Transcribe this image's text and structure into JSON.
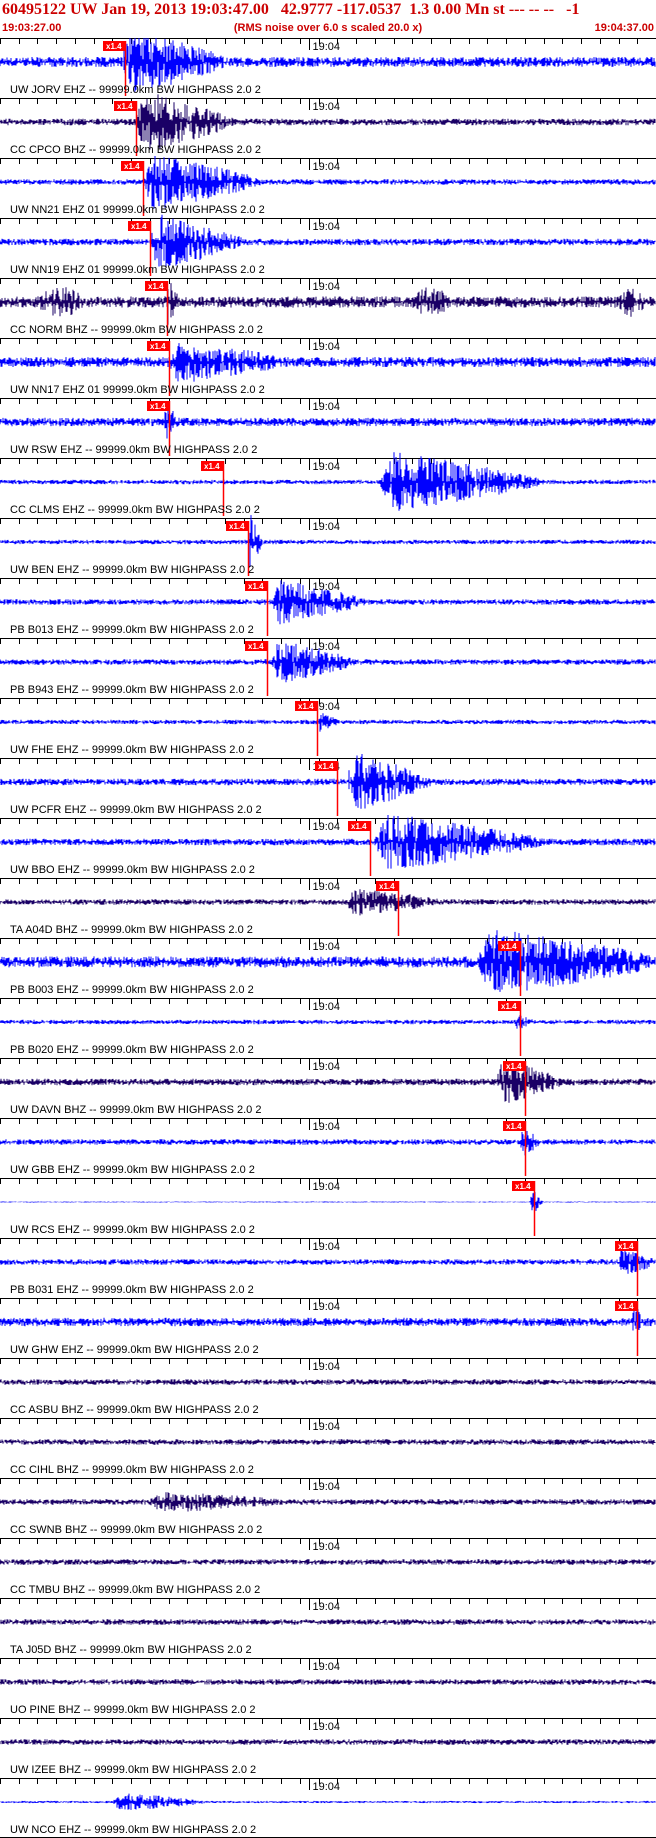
{
  "header": {
    "title": "60495122 UW Jan 19, 2013 19:03:47.00   42.9777 -117.0537  1.3 0.00 Mn st --- -- --   -1",
    "start_time": "19:03:27.00",
    "rms_note": "(RMS noise over 6.0 s scaled 20.0 x)",
    "end_time": "19:04:37.00"
  },
  "colors": {
    "trace_blue": "#0000ff",
    "trace_navy": "#1a0066",
    "pick_red": "#ff0000",
    "header_red": "#cc0000"
  },
  "chart_data": {
    "type": "waveform",
    "x_unit": "seconds after 19:03:27.00",
    "xlim": [
      0,
      70
    ],
    "minute_mark": {
      "label": "19:04",
      "t": 33
    },
    "pick_label": "x1.4",
    "tick_interval_s": 2,
    "traces": [
      {
        "label": "UW JORV EHZ -- 99999.0km BW  HIGHPASS  2.0  2",
        "color": "blue",
        "pick_t": 13.3,
        "burst_t": [
          13.0,
          24.0
        ],
        "amp": 0.18,
        "burst_amp": 1.0,
        "slow_bursts": []
      },
      {
        "label": "CC CPCO BHZ -- 99999.0km BW  HIGHPASS  2.0  2",
        "color": "navy",
        "pick_t": 14.5,
        "burst_t": [
          14.5,
          25.0
        ],
        "amp": 0.12,
        "burst_amp": 1.0,
        "slow_bursts": []
      },
      {
        "label": "UW NN21 EHZ 01 99999.0km BW  HIGHPASS  2.0  2",
        "color": "blue",
        "pick_t": 15.3,
        "burst_t": [
          15.3,
          28.0
        ],
        "amp": 0.1,
        "burst_amp": 0.9,
        "slow_bursts": []
      },
      {
        "label": "UW NN19 EHZ 01 99999.0km BW  HIGHPASS  2.0  2",
        "color": "blue",
        "pick_t": 16.0,
        "burst_t": [
          16.0,
          26.0
        ],
        "amp": 0.12,
        "burst_amp": 0.9,
        "slow_bursts": []
      },
      {
        "label": "CC NORM BHZ -- 99999.0km BW  HIGHPASS  2.0  2",
        "color": "navy",
        "pick_t": 17.8,
        "burst_t": [
          17.8,
          19.0
        ],
        "amp": 0.2,
        "burst_amp": 0.7,
        "slow_bursts": [
          [
            4,
            9
          ],
          [
            44,
            48
          ],
          [
            66,
            69
          ]
        ]
      },
      {
        "label": "UW NN17 EHZ 01 99999.0km BW  HIGHPASS  2.0  2",
        "color": "blue",
        "pick_t": 18.0,
        "burst_t": [
          18.0,
          30.0
        ],
        "amp": 0.18,
        "burst_amp": 0.6,
        "slow_bursts": []
      },
      {
        "label": "UW RSW EHZ -- 99999.0km BW  HIGHPASS  2.0  2",
        "color": "blue",
        "pick_t": 18.0,
        "burst_t": [
          17.5,
          19.0
        ],
        "amp": 0.15,
        "burst_amp": 0.6,
        "slow_bursts": []
      },
      {
        "label": "CC CLMS EHZ -- 99999.0km BW  HIGHPASS  2.0  2",
        "color": "blue",
        "pick_t": 23.8,
        "burst_t": [
          40.5,
          58.0
        ],
        "amp": 0.08,
        "burst_amp": 1.0,
        "slow_bursts": []
      },
      {
        "label": "UW BEN EHZ -- 99999.0km BW  HIGHPASS  2.0  2",
        "color": "blue",
        "pick_t": 26.5,
        "burst_t": [
          26.5,
          28.0
        ],
        "amp": 0.08,
        "burst_amp": 1.0,
        "slow_bursts": []
      },
      {
        "label": "PB B013 EHZ -- 99999.0km BW  HIGHPASS  2.0  2",
        "color": "blue",
        "pick_t": 28.5,
        "burst_t": [
          29.0,
          39.0
        ],
        "amp": 0.1,
        "burst_amp": 0.7,
        "slow_bursts": []
      },
      {
        "label": "PB B943 EHZ -- 99999.0km BW  HIGHPASS  2.0  2",
        "color": "blue",
        "pick_t": 28.5,
        "burst_t": [
          29.0,
          38.0
        ],
        "amp": 0.1,
        "burst_amp": 0.7,
        "slow_bursts": []
      },
      {
        "label": "UW FHE EHZ -- 99999.0km BW  HIGHPASS  2.0  2",
        "color": "blue",
        "pick_t": 33.8,
        "burst_t": [
          34.0,
          36.0
        ],
        "amp": 0.08,
        "burst_amp": 0.3,
        "slow_bursts": []
      },
      {
        "label": "UW PCFR EHZ -- 99999.0km BW  HIGHPASS  2.0  2",
        "color": "blue",
        "pick_t": 36.0,
        "burst_t": [
          37.0,
          46.0
        ],
        "amp": 0.12,
        "burst_amp": 1.0,
        "slow_bursts": []
      },
      {
        "label": "UW BBO EHZ -- 99999.0km BW  HIGHPASS  2.0  2",
        "color": "blue",
        "pick_t": 39.5,
        "burst_t": [
          40.0,
          58.0
        ],
        "amp": 0.12,
        "burst_amp": 0.9,
        "slow_bursts": []
      },
      {
        "label": "TA A04D BHZ -- 99999.0km BW  HIGHPASS  2.0  2",
        "color": "navy",
        "pick_t": 42.5,
        "burst_t": [
          37.0,
          47.0
        ],
        "amp": 0.1,
        "burst_amp": 0.4,
        "slow_bursts": []
      },
      {
        "label": "PB B003 EHZ -- 99999.0km BW  HIGHPASS  2.0  2",
        "color": "blue",
        "pick_t": 55.5,
        "burst_t": [
          51.0,
          70.0
        ],
        "amp": 0.2,
        "burst_amp": 1.0,
        "slow_bursts": []
      },
      {
        "label": "PB B020 EHZ -- 99999.0km BW  HIGHPASS  2.0  2",
        "color": "blue",
        "pick_t": 55.5,
        "burst_t": [
          55.0,
          57.0
        ],
        "amp": 0.08,
        "burst_amp": 0.2,
        "slow_bursts": []
      },
      {
        "label": "UW DAVN BHZ -- 99999.0km BW  HIGHPASS  2.0  2",
        "color": "navy",
        "pick_t": 56.0,
        "burst_t": [
          53.0,
          60.0
        ],
        "amp": 0.12,
        "burst_amp": 0.7,
        "slow_bursts": []
      },
      {
        "label": "UW GBB EHZ -- 99999.0km BW  HIGHPASS  2.0  2",
        "color": "blue",
        "pick_t": 56.0,
        "burst_t": [
          55.5,
          57.5
        ],
        "amp": 0.1,
        "burst_amp": 0.5,
        "slow_bursts": []
      },
      {
        "label": "UW RCS EHZ -- 99999.0km BW  HIGHPASS  2.0  2",
        "color": "blue",
        "pick_t": 57.0,
        "burst_t": [
          56.5,
          58.0
        ],
        "amp": 0.02,
        "burst_amp": 0.5,
        "slow_bursts": []
      },
      {
        "label": "PB B031 EHZ -- 99999.0km BW  HIGHPASS  2.0  2",
        "color": "blue",
        "pick_t": 68.0,
        "burst_t": [
          66.0,
          70.0
        ],
        "amp": 0.1,
        "burst_amp": 0.4,
        "slow_bursts": []
      },
      {
        "label": "UW GHW EHZ -- 99999.0km BW  HIGHPASS  2.0  2",
        "color": "blue",
        "pick_t": 68.0,
        "burst_t": [
          67.5,
          68.5
        ],
        "amp": 0.15,
        "burst_amp": 0.6,
        "slow_bursts": []
      },
      {
        "label": "CC ASBU BHZ -- 99999.0km BW  HIGHPASS  2.0  2",
        "color": "navy",
        "pick_t": null,
        "burst_t": null,
        "amp": 0.1,
        "burst_amp": 0,
        "slow_bursts": []
      },
      {
        "label": "CC CIHL BHZ -- 99999.0km BW  HIGHPASS  2.0  2",
        "color": "navy",
        "pick_t": null,
        "burst_t": null,
        "amp": 0.1,
        "burst_amp": 0,
        "slow_bursts": []
      },
      {
        "label": "CC SWNB BHZ -- 99999.0km BW  HIGHPASS  2.0  2",
        "color": "navy",
        "pick_t": null,
        "burst_t": [
          16.0,
          30.0
        ],
        "amp": 0.1,
        "burst_amp": 0.3,
        "slow_bursts": []
      },
      {
        "label": "CC TMBU BHZ -- 99999.0km BW  HIGHPASS  2.0  2",
        "color": "navy",
        "pick_t": null,
        "burst_t": null,
        "amp": 0.1,
        "burst_amp": 0,
        "slow_bursts": []
      },
      {
        "label": "TA J05D BHZ -- 99999.0km BW  HIGHPASS  2.0  2",
        "color": "navy",
        "pick_t": null,
        "burst_t": null,
        "amp": 0.1,
        "burst_amp": 0,
        "slow_bursts": []
      },
      {
        "label": "UO PINE BHZ -- 99999.0km BW  HIGHPASS  2.0  2",
        "color": "navy",
        "pick_t": null,
        "burst_t": null,
        "amp": 0.1,
        "burst_amp": 0,
        "slow_bursts": []
      },
      {
        "label": "UW IZEE BHZ -- 99999.0km BW  HIGHPASS  2.0  2",
        "color": "navy",
        "pick_t": null,
        "burst_t": null,
        "amp": 0.1,
        "burst_amp": 0,
        "slow_bursts": []
      },
      {
        "label": "UW NCO EHZ -- 99999.0km BW  HIGHPASS  2.0  2",
        "color": "blue",
        "pick_t": null,
        "burst_t": [
          12.0,
          22.0
        ],
        "amp": 0.04,
        "burst_amp": 0.3,
        "slow_bursts": []
      }
    ]
  }
}
